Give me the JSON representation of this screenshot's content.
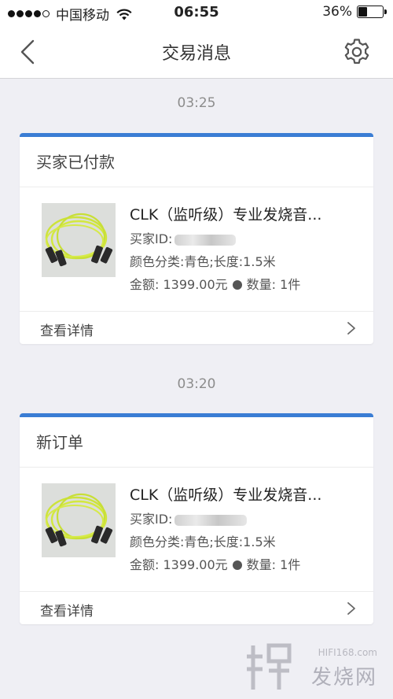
{
  "status_bar": {
    "carrier": "中国移动",
    "time": "06:55",
    "battery": "36%",
    "battery_level": 0.36,
    "signal_bars": 4
  },
  "nav": {
    "title": "交易消息",
    "back_icon": "chevron-left-icon",
    "settings_icon": "gear-icon"
  },
  "messages": [
    {
      "time": "03:25",
      "status": "买家已付款",
      "product_title": "CLK（监听级）专业发烧音...",
      "buyer_id_label": "买家ID:",
      "specs": "颜色分类:青色;长度:1.5米",
      "amount": "金额: 1399.00元",
      "quantity": "数量: 1件",
      "details_link": "查看详情"
    },
    {
      "time": "03:20",
      "status": "新订单",
      "product_title": "CLK（监听级）专业发烧音...",
      "buyer_id_label": "买家ID:",
      "specs": "颜色分类:青色;长度:1.5米",
      "amount": "金额: 1399.00元",
      "quantity": "数量: 1件",
      "details_link": "查看详情"
    }
  ],
  "watermark": {
    "url": "HIFI168.com",
    "name": "发烧网"
  },
  "colors": {
    "accent": "#3a7dd4",
    "background": "#efeff4",
    "cable": "#cde33a"
  }
}
